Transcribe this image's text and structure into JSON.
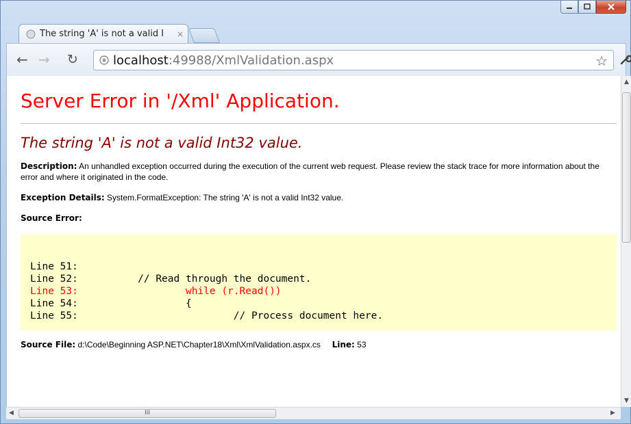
{
  "tab": {
    "title": "The string 'A' is not a valid I",
    "close": "×"
  },
  "address": {
    "host": "localhost",
    "rest": ":49988/XmlValidation.aspx"
  },
  "page": {
    "heading": "Server Error in '/Xml' Application.",
    "subheading": "The string 'A' is not a valid Int32 value.",
    "description_label": "Description:",
    "description_text": "An unhandled exception occurred during the execution of the current web request. Please review the stack trace for more information about the error and where it originated in the code.",
    "exception_label": "Exception Details:",
    "exception_text": "System.FormatException: The string 'A' is not a valid Int32 value.",
    "source_error_label": "Source Error:",
    "code_lines": [
      {
        "text": "Line 51:"
      },
      {
        "text": "Line 52:          // Read through the document."
      },
      {
        "text": "Line 53:                  while (r.Read())"
      },
      {
        "text": "Line 54:                  {"
      },
      {
        "text": "Line 55:                          // Process document here."
      }
    ],
    "source_file_label": "Source File:",
    "source_file_path": "d:\\Code\\Beginning ASP.NET\\Chapter18\\Xml\\XmlValidation.aspx.cs",
    "line_label": "Line:",
    "line_number": "53"
  },
  "scrollbar": {
    "thumb_grip": "III"
  },
  "colors": {
    "heading": "#ff0000",
    "subheading": "#800000",
    "code_background": "#ffffcc",
    "error_line": "#ff0000"
  }
}
